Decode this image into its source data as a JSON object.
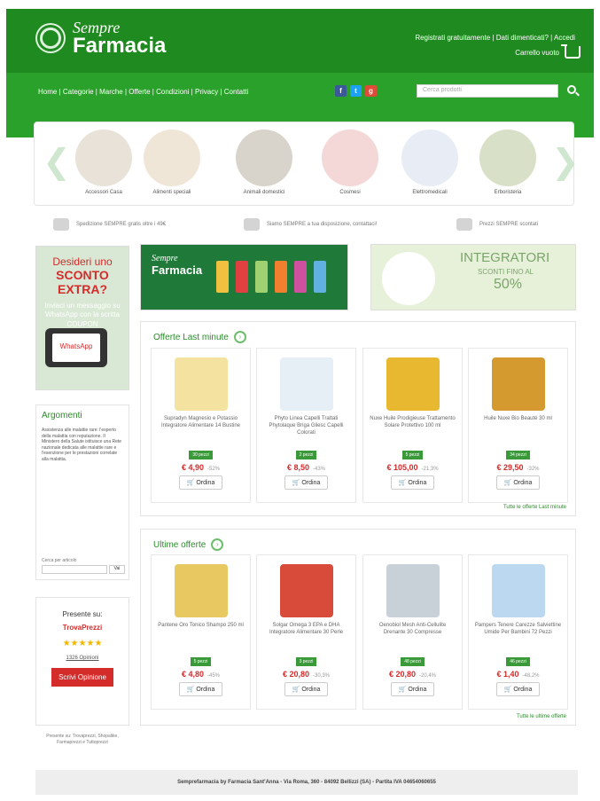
{
  "brand": {
    "line1": "Sempre",
    "line2": "Farmacia"
  },
  "header": {
    "top_links": "Registrati gratuitamente | Dati dimenticati? | Accedi",
    "cart_label": "Carrello vuoto"
  },
  "nav": {
    "links": "Home | Categorie | Marche | Offerte | Condizioni | Privacy | Contatti",
    "search_placeholder": "Cerca prodotti"
  },
  "categories": [
    {
      "label": "Accessori Casa",
      "color": "#e8e2d8"
    },
    {
      "label": "Alimenti speciali",
      "color": "#f0e6d8"
    },
    {
      "label": "Animali domestici",
      "color": "#d8d4cc"
    },
    {
      "label": "Cosmesi",
      "color": "#f4d8d8"
    },
    {
      "label": "Elettromedicali",
      "color": "#e8ecf4"
    },
    {
      "label": "Erboristeria",
      "color": "#d8e0c8"
    }
  ],
  "features": [
    "Spedizione SEMPRE gratis oltre i 49€",
    "Siamo SEMPRE a tua disposizione, contattaci!",
    "Prezzi SEMPRE scontati"
  ],
  "left_promo": {
    "line1": "Desideri uno",
    "line2": "SCONTO EXTRA?",
    "line3": "Inviaci un messaggio su WhatsApp con la scritta COUPON",
    "phone_text": "WhatsApp"
  },
  "argomenti": {
    "title": "Argomenti",
    "text": "Assistenza alle malattie rare: l'esperto della malattia con reputazione. Il Ministero della Salute istituisce una Rete nazionale dedicata alle malattie rare e l'esenzione per le prestazioni correlate alla malattia.",
    "search_label": "Cerca per articolo",
    "search_button": "Vai"
  },
  "presente": {
    "title": "Presente su:",
    "brand": "TrovaPrezzi",
    "stars": "★★★★★",
    "link": "1326 Opinioni",
    "button": "Scrivi Opinione"
  },
  "bottom_note": "Presente su: Trovaprezzi, Shopalike, Farmaprezzi e Tuttoprezzi",
  "banner_left": {
    "line1": "Sempre",
    "line2": "Farmacia"
  },
  "banner_right": {
    "line1": "INTEGRATORI",
    "line2": "SCONTI FINO AL",
    "line3": "50%"
  },
  "offerte": {
    "title": "Offerte Last minute",
    "all_link": "Tutte le offerte Last minute",
    "products": [
      {
        "name": "Supradyn Magnesio e Potassio Integratore Alimentare 14 Bustine",
        "badge": "30 pezzi",
        "price": "€ 4,90",
        "discount": "-52%",
        "order": "Ordina",
        "color": "#f4e3a0"
      },
      {
        "name": "Phyto Linea Capelli Trattati Phytolaque Briga Gliesc Capelli Colorati",
        "badge": "2 pezzi",
        "price": "€ 8,50",
        "discount": "-43%",
        "order": "Ordina",
        "color": "#e6eef6"
      },
      {
        "name": "Nuxe Huile Prodigieuse Trattamento Solare Protettivo 100 ml",
        "badge": "5 pezzi",
        "price": "€ 105,00",
        "discount": "-21,3%",
        "order": "Ordina",
        "color": "#e8b830"
      },
      {
        "name": "Huile Nuxe Bio Beauté 30 ml",
        "badge": "34 pezzi",
        "price": "€ 29,50",
        "discount": "-32%",
        "order": "Ordina",
        "color": "#d49a30"
      }
    ]
  },
  "ultime": {
    "title": "Ultime offerte",
    "all_link": "Tutte le ultime offerte",
    "products": [
      {
        "name": "Pantene Oro Tonico Shampo 250 ml",
        "badge": "5 pezzi",
        "price": "€ 4,80",
        "discount": "-45%",
        "order": "Ordina",
        "color": "#e8c860"
      },
      {
        "name": "Solgar Omega 3 EPA e DHA Integratore Alimentare 30 Perle",
        "badge": "3 pezzi",
        "price": "€ 20,80",
        "discount": "-30,3%",
        "order": "Ordina",
        "color": "#d84a3a"
      },
      {
        "name": "Oenobiol Mesh Anti-Cellulite Drenante 30 Compresse",
        "badge": "48 pezzi",
        "price": "€ 20,80",
        "discount": "-20,4%",
        "order": "Ordina",
        "color": "#c8d0d8"
      },
      {
        "name": "Pampers Tenere Carezze Salviettine Umide Per Bambini 72 Pezzi",
        "badge": "46 pezzi",
        "price": "€ 1,40",
        "discount": "-48,2%",
        "order": "Ordina",
        "color": "#bcd8f0"
      }
    ]
  },
  "footer": "Semprefarmacia by Farmacia Sant'Anna - Via Roma, 360 - 84092 Bellizzi (SA) - Partita IVA 04654060655"
}
